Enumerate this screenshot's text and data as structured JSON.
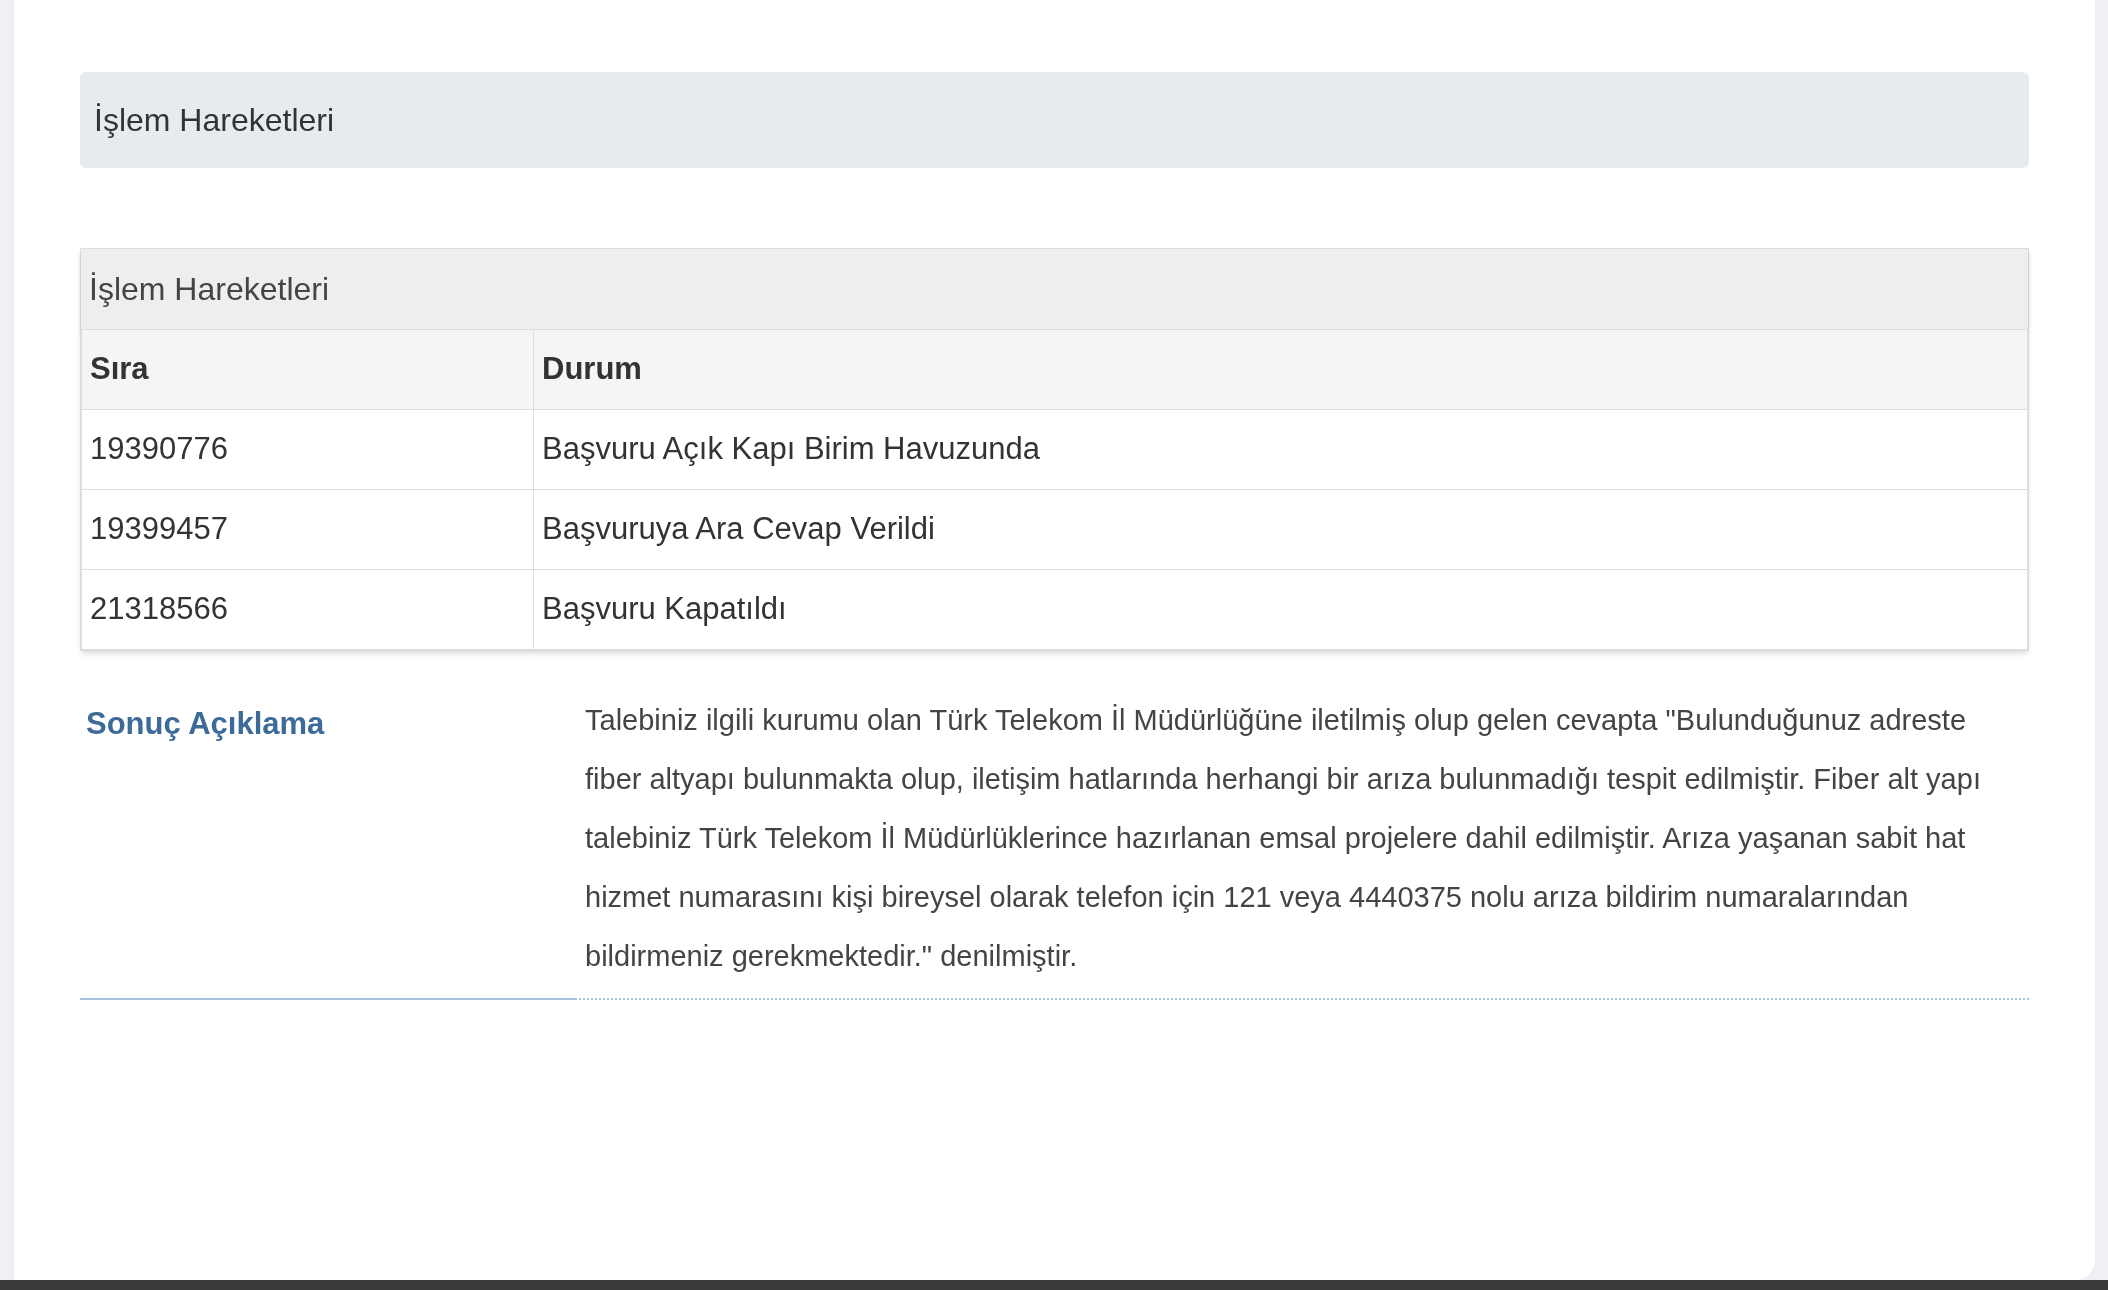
{
  "section_header": {
    "title": "İşlem Hareketleri"
  },
  "table": {
    "caption": "İşlem Hareketleri",
    "columns": [
      "Sıra",
      "Durum"
    ],
    "rows": [
      [
        "19390776",
        "Başvuru Açık Kapı Birim Havuzunda"
      ],
      [
        "19399457",
        "Başvuruya Ara Cevap Verildi"
      ],
      [
        "21318566",
        "Başvuru Kapatıldı"
      ]
    ]
  },
  "result": {
    "label": "Sonuç Açıklama",
    "text": "Talebiniz ilgili kurumu olan Türk Telekom İl Müdürlüğüne iletilmiş olup gelen cevapta \"Bulunduğunuz adreste fiber altyapı bulunmakta olup, iletişim hatlarında herhangi bir arıza bulunmadığı tespit edilmiştir. Fiber alt yapı talebiniz Türk Telekom İl Müdürlüklerince hazırlanan emsal projelere dahil edilmiştir. Arıza yaşanan sabit hat hizmet numarasını kişi bireysel olarak telefon için 121 veya 4440375 nolu arıza bildirim numaralarından bildirmeniz gerekmektedir.\" denilmiştir."
  }
}
